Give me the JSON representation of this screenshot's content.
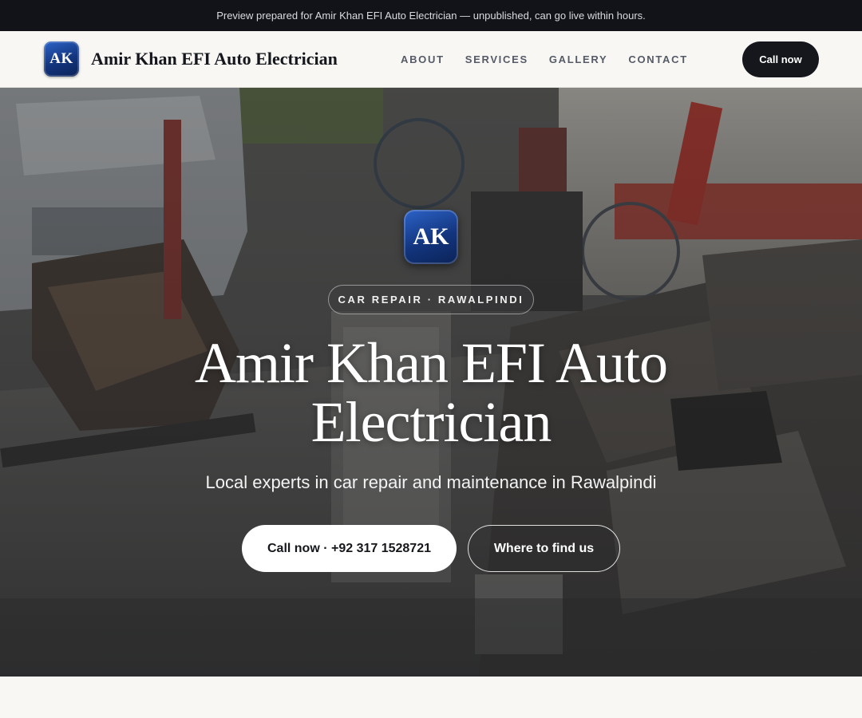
{
  "banner": {
    "text": "Preview prepared for Amir Khan EFI Auto Electrician — unpublished, can go live within hours."
  },
  "header": {
    "logo_initials": "AK",
    "brand_name": "Amir Khan EFI Auto Electrician",
    "nav": [
      {
        "label": "ABOUT"
      },
      {
        "label": "SERVICES"
      },
      {
        "label": "GALLERY"
      },
      {
        "label": "CONTACT"
      }
    ],
    "call_label": "Call now"
  },
  "hero": {
    "badge_initials": "AK",
    "tagline": "CAR REPAIR · RAWALPINDI",
    "title": "Amir Khan EFI Auto Electrician",
    "subtitle": "Local experts in car repair and maintenance in Rawalpindi",
    "primary_button": "Call now · +92 317 1528721",
    "secondary_button": "Where to find us"
  },
  "colors": {
    "brand_blue": "#13357e",
    "dark": "#15171c",
    "page_bg": "#f8f7f4"
  }
}
